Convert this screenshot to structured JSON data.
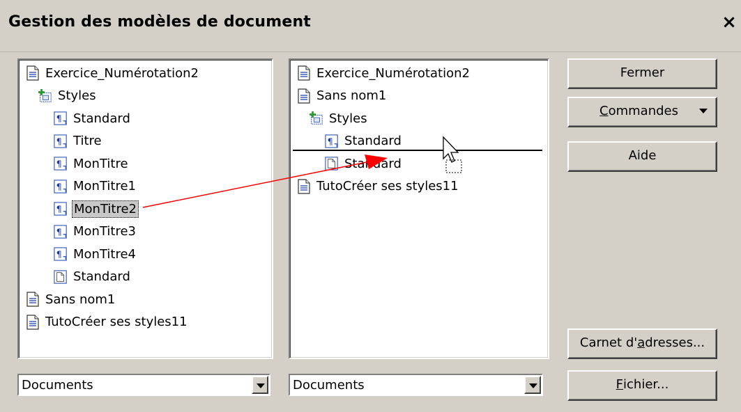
{
  "window": {
    "title": "Gestion des modèles de document",
    "close_glyph": "×"
  },
  "left_tree": [
    {
      "label": "Exercice_Numérotation2",
      "icon": "document-icon"
    },
    {
      "label": "Styles",
      "icon": "styles-folder-icon"
    },
    {
      "label": "Standard",
      "icon": "paragraph-style-icon"
    },
    {
      "label": "Titre",
      "icon": "paragraph-style-icon"
    },
    {
      "label": "MonTitre",
      "icon": "paragraph-style-icon"
    },
    {
      "label": "MonTitre1",
      "icon": "paragraph-style-icon"
    },
    {
      "label": "MonTitre2",
      "icon": "paragraph-style-icon",
      "selected": true
    },
    {
      "label": "MonTitre3",
      "icon": "paragraph-style-icon"
    },
    {
      "label": "MonTitre4",
      "icon": "paragraph-style-icon"
    },
    {
      "label": "Standard",
      "icon": "page-style-icon"
    },
    {
      "label": "Sans nom1",
      "icon": "document-icon"
    },
    {
      "label": "TutoCréer ses styles11",
      "icon": "document-icon"
    }
  ],
  "right_tree": [
    {
      "label": "Exercice_Numérotation2",
      "icon": "document-icon"
    },
    {
      "label": "Sans nom1",
      "icon": "document-icon"
    },
    {
      "label": "Styles",
      "icon": "styles-folder-icon"
    },
    {
      "label": "Standard",
      "icon": "paragraph-style-icon"
    },
    {
      "label": "Standard",
      "icon": "page-style-icon"
    },
    {
      "label": "TutoCréer ses styles11",
      "icon": "document-icon"
    }
  ],
  "buttons": {
    "fermer": "Fermer",
    "commandes_u": "C",
    "commandes_rest": "ommandes",
    "aide": "Aide",
    "carnet_pre": "Carnet d'",
    "carnet_u": "a",
    "carnet_post": "dresses...",
    "fichier_u": "F",
    "fichier_rest": "ichier..."
  },
  "left_combo": {
    "value": "Documents"
  },
  "right_combo": {
    "value": "Documents"
  },
  "colors": {
    "drag_arrow": "#ff0000"
  }
}
